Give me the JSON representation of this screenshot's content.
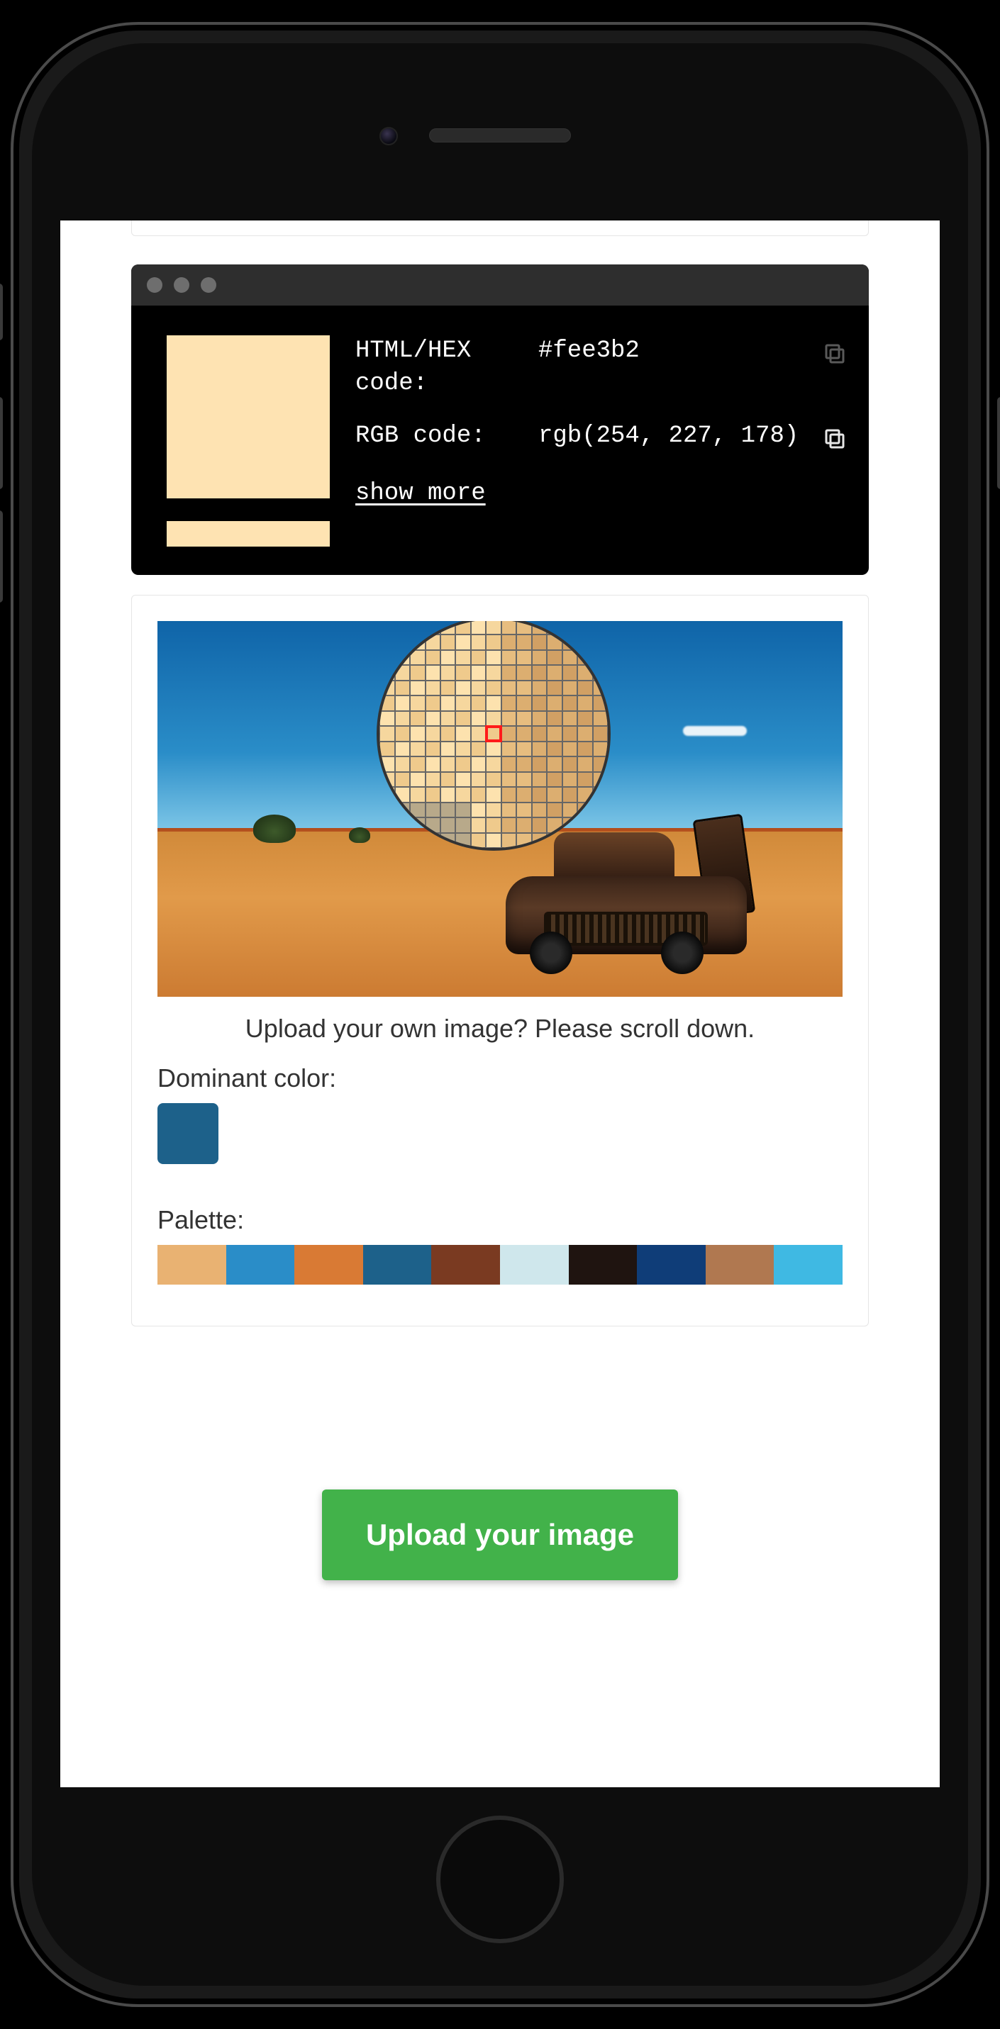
{
  "terminal": {
    "swatch_color": "#fee3b2",
    "hex_label": "HTML/HEX code:",
    "hex_value": "#fee3b2",
    "rgb_label": "RGB code:",
    "rgb_value": "rgb(254, 227, 178)",
    "show_more": "show more"
  },
  "picker": {
    "caption": "Upload your own image? Please scroll down.",
    "dominant_label": "Dominant color:",
    "dominant_color": "#1d618a",
    "palette_label": "Palette:",
    "palette": [
      "#e9b272",
      "#2a8dc8",
      "#d97a34",
      "#1d618a",
      "#7a3a21",
      "#cfe7ec",
      "#1f1410",
      "#0f3d78",
      "#b07850",
      "#3fb9e3"
    ]
  },
  "upload": {
    "button": "Upload your image"
  }
}
